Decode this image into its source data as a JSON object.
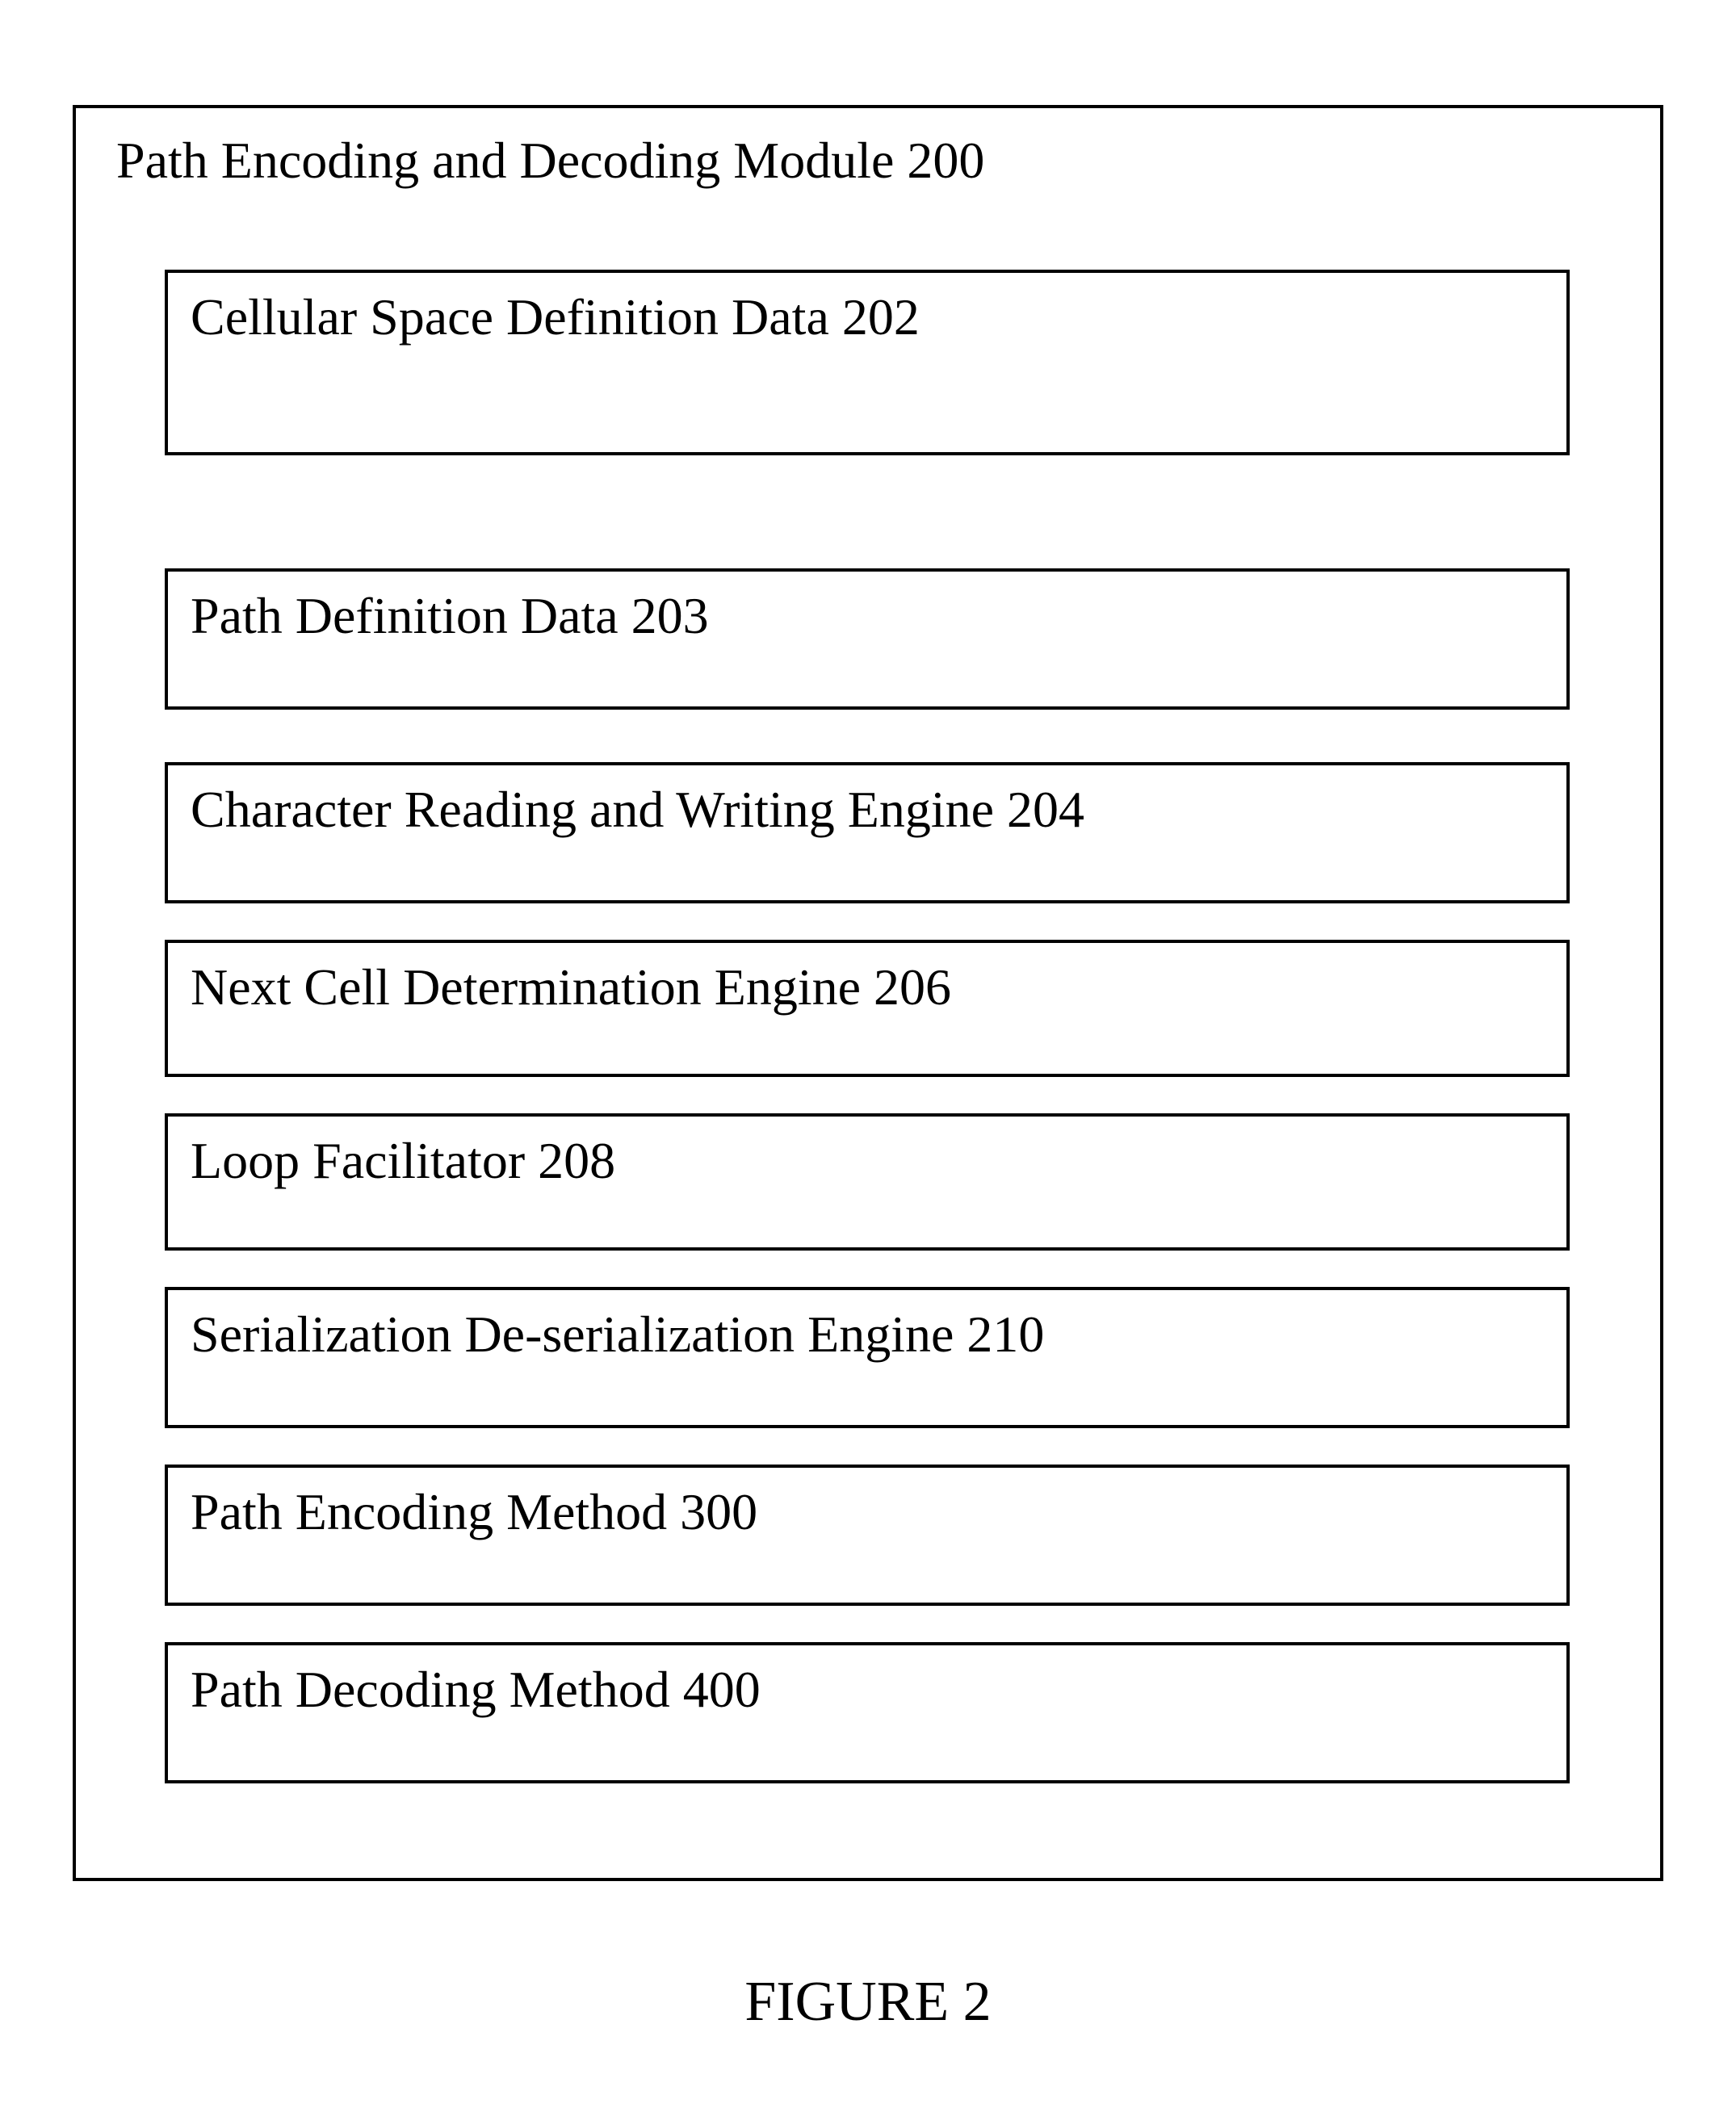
{
  "module": {
    "title": "Path Encoding and Decoding Module 200",
    "components": [
      {
        "label": "Cellular Space Definition Data 202"
      },
      {
        "label": "Path Definition Data 203"
      },
      {
        "label": "Character Reading and Writing Engine 204"
      },
      {
        "label": "Next Cell Determination Engine 206"
      },
      {
        "label": "Loop Facilitator 208"
      },
      {
        "label": "Serialization De-serialization Engine 210"
      },
      {
        "label": "Path Encoding Method 300"
      },
      {
        "label": "Path Decoding Method 400"
      }
    ]
  },
  "figure_caption": "FIGURE 2"
}
